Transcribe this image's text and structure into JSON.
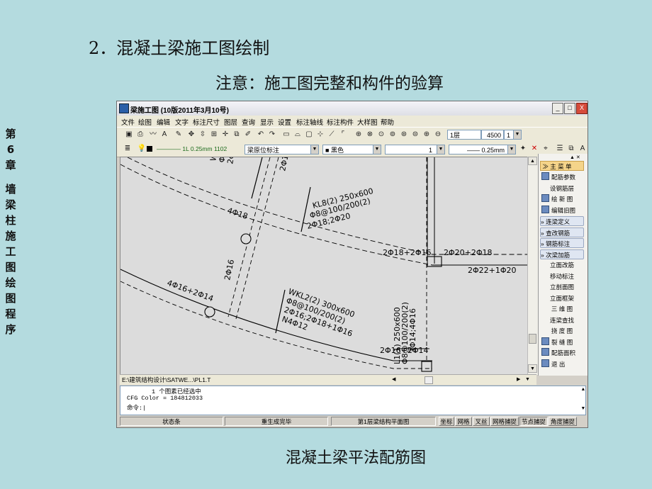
{
  "slide": {
    "heading": "2．混凝土梁施工图绘制",
    "notice": "注意：施工图完整和构件的验算",
    "caption": "混凝土梁平法配筋图",
    "chapter": [
      "第",
      "6",
      "章",
      "墙",
      "梁",
      "柱",
      "施",
      "工",
      "图",
      "绘",
      "图",
      "程",
      "序"
    ]
  },
  "window": {
    "title": "梁施工图 (10版2011年3月10号)",
    "buttons": [
      "_",
      "□",
      "X"
    ]
  },
  "menu": [
    "文件",
    "绘图",
    "编辑",
    "文字",
    "标注尺寸",
    "图层",
    "查询",
    "显示",
    "设置",
    "标注轴线",
    "标注构件",
    "大样图",
    "帮助"
  ],
  "toolbar1": {
    "floor": "1层",
    "value": "4500",
    "count": "1"
  },
  "toolbar2": {
    "line_label": "1L 0.25mm 1102",
    "layer": "梁原位标注",
    "color": "黑色",
    "linetype_num": "1",
    "linewidth": "0.25mm"
  },
  "right_panel": {
    "head": "主 菜 单",
    "items": [
      {
        "label": "配筋参数",
        "type": "icon"
      },
      {
        "label": "设钢筋层",
        "type": "sub"
      },
      {
        "label": "绘 新 图",
        "type": "icon"
      },
      {
        "label": "编辑旧图",
        "type": "icon"
      },
      {
        "label": "连梁定义",
        "type": "sec"
      },
      {
        "label": "查改钢筋",
        "type": "sec"
      },
      {
        "label": "钢筋标注",
        "type": "sec"
      },
      {
        "label": "次梁加筋",
        "type": "sec"
      },
      {
        "label": "立面改筋",
        "type": "sub"
      },
      {
        "label": "移动标注",
        "type": "sub"
      },
      {
        "label": "立剖面图",
        "type": "sub"
      },
      {
        "label": "立面框架",
        "type": "sub"
      },
      {
        "label": "三 维 图",
        "type": "sub"
      },
      {
        "label": "连梁查找",
        "type": "sub"
      },
      {
        "label": "挠 度 图",
        "type": "sub"
      },
      {
        "label": "裂 缝 图",
        "type": "icon"
      },
      {
        "label": "配筋面积",
        "type": "icon"
      },
      {
        "label": "退    出",
        "type": "icon"
      }
    ]
  },
  "path": "E:\\建筑结构设计\\SATWE...\\PL1.T",
  "command": {
    "line1": "1 个图素已经选中",
    "line2": "CFG Color = 184812033",
    "prompt": "命令:"
  },
  "status": [
    "状态条",
    "重生成完毕",
    "第1层梁结构平面图",
    "坐标",
    "网格",
    "叉丝",
    "网格捕捉",
    "节点捕捉",
    "角度捕捉"
  ],
  "drawing": {
    "labels": {
      "a": "4Φ18",
      "b": "KL8(2) 250x600",
      "c": "Φ8@100/200(2)",
      "d": "2Φ18;2Φ20",
      "e": "2Φ18+2Φ16",
      "f": "2Φ20+2Φ18",
      "g": "2Φ22+1Φ20",
      "h": "2Φ16",
      "i": "4Φ16+2Φ14",
      "j": "WKL2(2) 300x600",
      "k": "Φ8@100/200(2)",
      "l": "2Φ16;2Φ18+1Φ16",
      "m": "N4Φ12",
      "n": "2Φ16+2Φ14",
      "o": "L1(1) 250x600",
      "p": "Φ8@100/200(2)",
      "q": "3Φ14;4Φ16",
      "r": "2Φ1",
      "s": "WK",
      "t": "Φ8",
      "u": "2Φ1"
    }
  }
}
